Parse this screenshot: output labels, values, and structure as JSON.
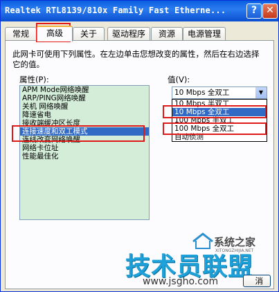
{
  "window": {
    "title": "Realtek RTL8139/810x Family Fast Etherne...",
    "help_glyph": "?",
    "close_glyph": "✕"
  },
  "tabs": [
    "常规",
    "高级",
    "关于",
    "驱动程序",
    "资源",
    "电源管理"
  ],
  "active_tab": "高级",
  "description": "此网卡可使用下列属性。在左边单击您想改变的属性，然后在右边选择它的值。",
  "property_label": "属性(P):",
  "value_label": "值(V):",
  "properties": [
    "APM Mode网络唤醒",
    "ARP/PING网络唤醒",
    "关机 网络唤醒",
    "降速省电",
    "接收端缓冲区长度",
    "连接速度和双工模式",
    "连线改变网络唤醒",
    "网络卡位址",
    "性能最佳化"
  ],
  "selected_property_index": 5,
  "value_current": "10 Mbps 全双工",
  "value_options": [
    "10 Mbps 半双工",
    "10 Mbps 全双工",
    "100 Mbps 半双工",
    "100 Mbps 全双工",
    "自动侦测"
  ],
  "selected_value_index": 1,
  "watermark": {
    "site_name": "系统之家",
    "site_url_small": "XITONGZHIJIA.NET",
    "brand": "技术员联盟",
    "url": "www.jsgho.com"
  },
  "cancel_fragment": "消",
  "colors": {
    "highlight": "#316AC5",
    "annotation_red": "#E01818",
    "list_bg": "#D4EDD8"
  }
}
